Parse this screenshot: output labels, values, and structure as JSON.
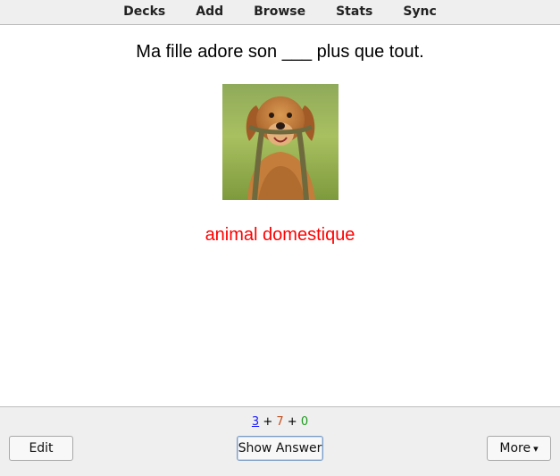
{
  "menu": {
    "items": [
      "Decks",
      "Add",
      "Browse",
      "Stats",
      "Sync"
    ]
  },
  "card": {
    "question": "Ma fille adore son ___ plus que tout.",
    "hint": "animal domestique",
    "hint_color": "#ff0000"
  },
  "counts": {
    "new": "3",
    "learn": "7",
    "review": "0",
    "separator": "+"
  },
  "buttons": {
    "edit": "Edit",
    "show_answer": "Show Answer",
    "more": "More"
  }
}
